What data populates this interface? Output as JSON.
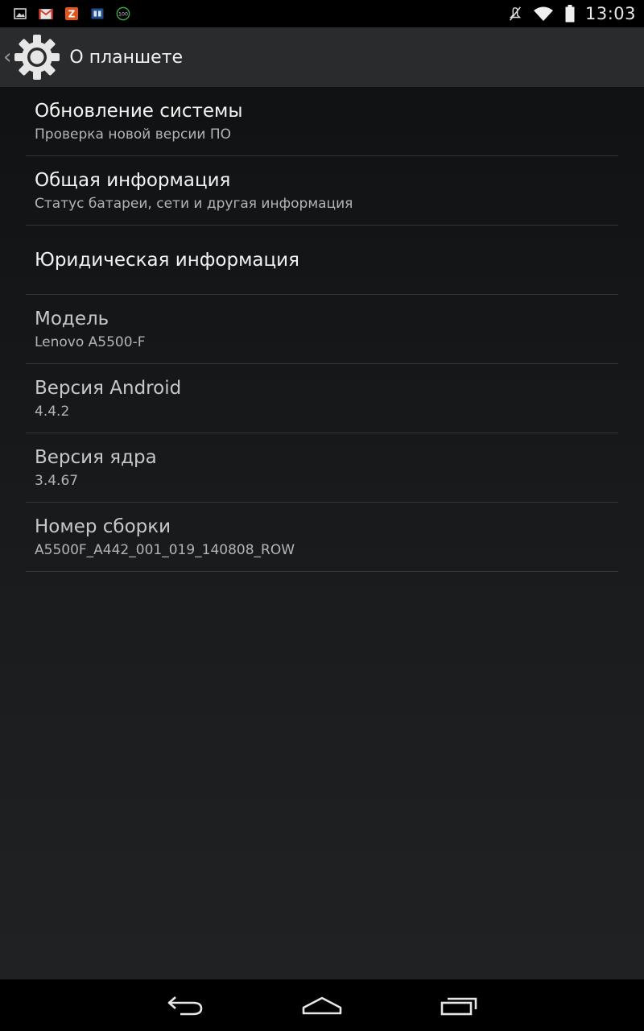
{
  "status_bar": {
    "time": "13:03",
    "notification_icons": [
      "gallery-icon",
      "gmail-icon",
      "zinio-icon",
      "app-icon",
      "battery-100-icon"
    ],
    "battery_badge": "100",
    "system_icons": [
      "mute-icon",
      "wifi-icon",
      "battery-icon"
    ],
    "colors": {
      "gmail_red": "#d9402f",
      "zinio_orange": "#e0561e",
      "green_badge": "#3aa54a"
    }
  },
  "action_bar": {
    "title": "О планшете",
    "icon": "gear-icon"
  },
  "preferences": [
    {
      "title": "Обновление системы",
      "summary": "Проверка новой версии ПО"
    },
    {
      "title": "Общая информация",
      "summary": "Статус батареи, сети и другая информация"
    },
    {
      "title": "Юридическая информация",
      "summary": ""
    },
    {
      "title": "Модель",
      "summary": "Lenovo A5500-F"
    },
    {
      "title": "Версия Android",
      "summary": "4.4.2"
    },
    {
      "title": "Версия ядра",
      "summary": "3.4.67"
    },
    {
      "title": "Номер сборки",
      "summary": "A5500F_A442_001_019_140808_ROW"
    }
  ],
  "nav_bar": {
    "buttons": [
      "back-icon",
      "home-icon",
      "recents-icon"
    ]
  }
}
